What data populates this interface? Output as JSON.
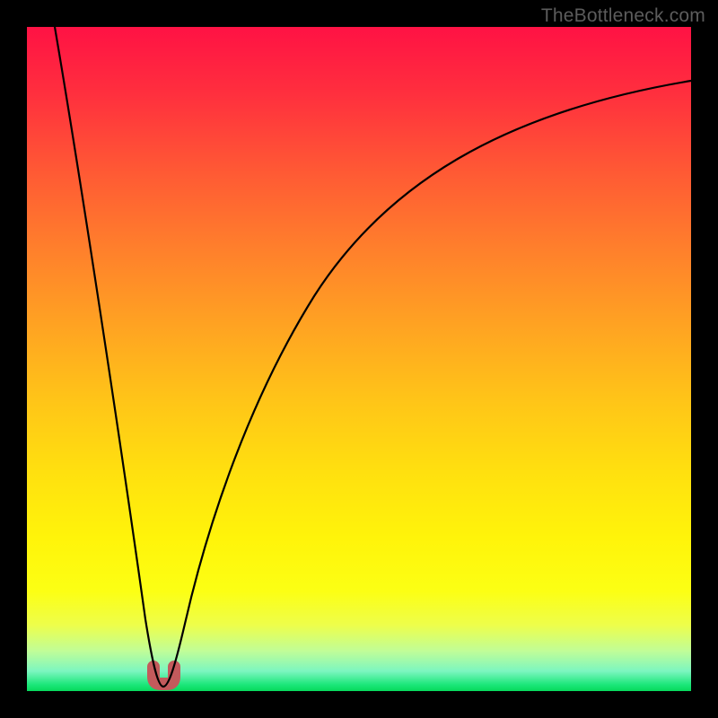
{
  "watermark": "TheBottleneck.com",
  "chart_data": {
    "type": "line",
    "title": "",
    "xlabel": "",
    "ylabel": "",
    "xlim": [
      0,
      100
    ],
    "ylim": [
      0,
      100
    ],
    "grid": false,
    "note": "x = relative performance position on a normalized axis; y = bottleneck percentage. Minimum (~0%) occurs near x≈20.5. Values estimated from plot pixels.",
    "series": [
      {
        "name": "bottleneck-curve",
        "x": [
          5,
          8,
          11,
          14,
          17,
          19,
          20,
          21,
          22,
          24,
          27,
          31,
          36,
          42,
          50,
          60,
          72,
          86,
          100
        ],
        "y": [
          100,
          80,
          60,
          40,
          20,
          6,
          1,
          1,
          4,
          12,
          25,
          38,
          50,
          60,
          70,
          78,
          84,
          88,
          91
        ]
      }
    ],
    "annotations": [
      {
        "name": "minimum-marker",
        "x": 20.5,
        "y": 0.5,
        "shape": "u-stub",
        "color": "#c35a5c"
      }
    ],
    "background_gradient": {
      "top": "#ff1244",
      "mid": "#ffe00f",
      "bottom": "#06d95c"
    }
  }
}
